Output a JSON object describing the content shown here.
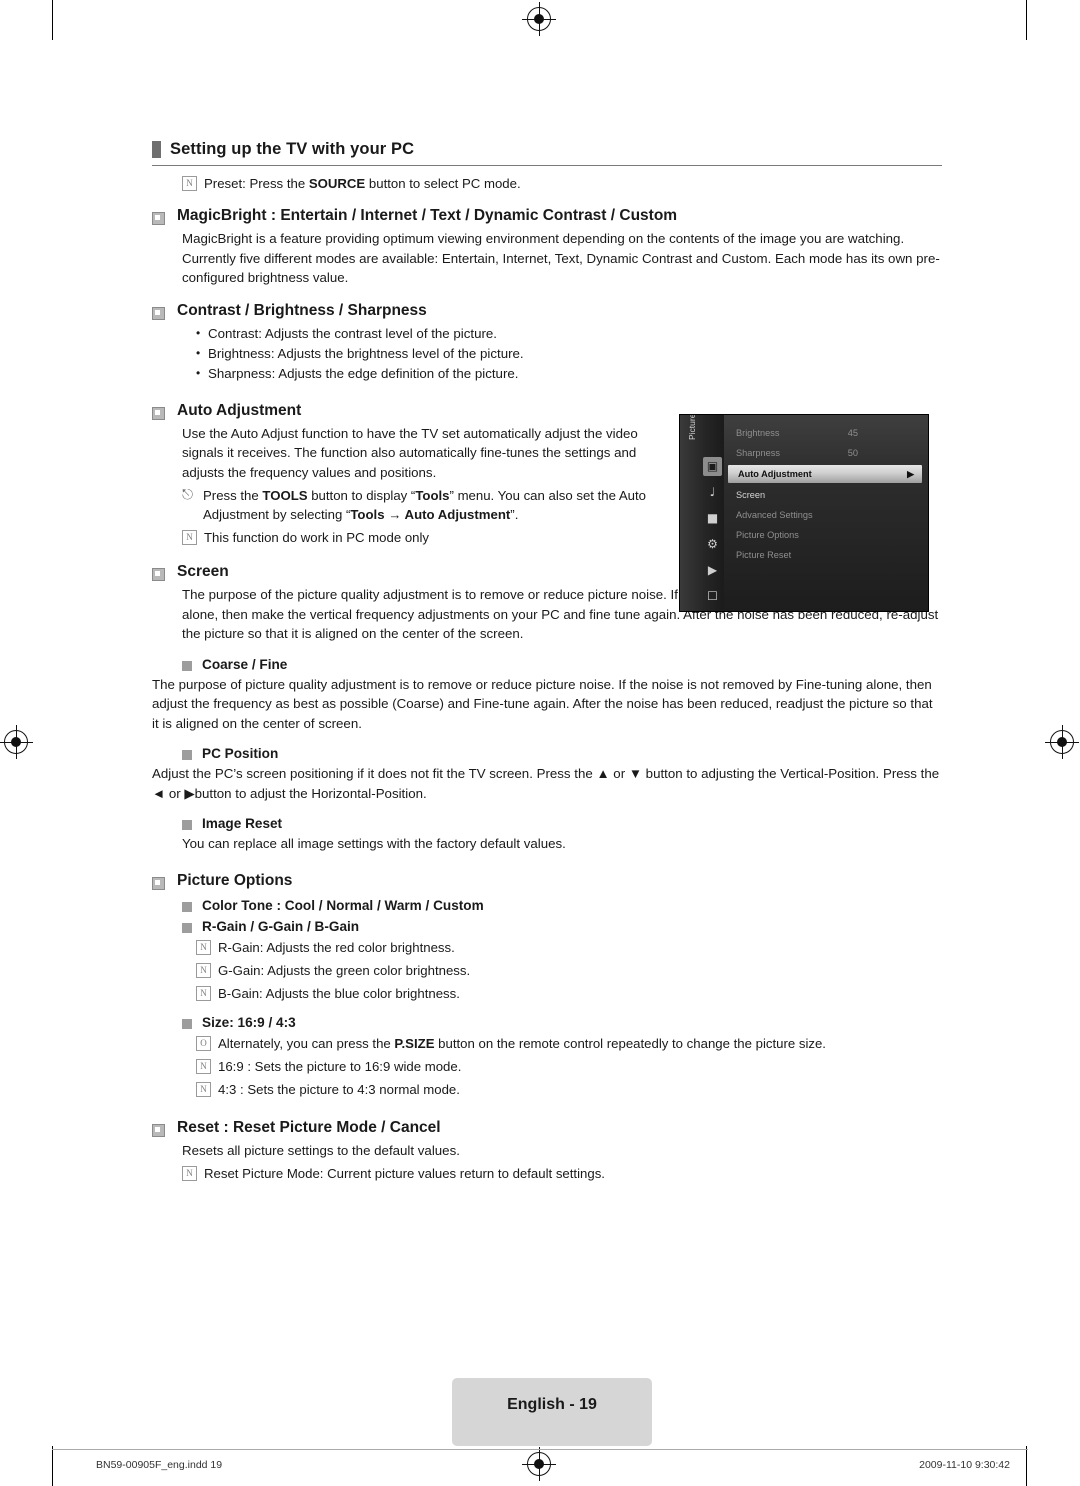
{
  "document": {
    "section_title": "Setting up the TV with your PC",
    "preset_note": "Preset: Press the SOURCE button to select PC mode.",
    "headings": {
      "magicbright": "MagicBright : Entertain / Internet / Text / Dynamic Contrast / Custom",
      "contrast": "Contrast / Brightness / Sharpness",
      "auto_adjustment": "Auto Adjustment",
      "screen": "Screen",
      "coarse_fine": "Coarse / Fine",
      "pc_position": "PC Position",
      "image_reset": "Image Reset",
      "picture_options": "Picture Options",
      "color_tone": "Color Tone : Cool / Normal / Warm / Custom",
      "gains": "R-Gain / G-Gain / B-Gain",
      "size": "Size: 16:9 / 4:3",
      "reset": "Reset : Reset Picture Mode / Cancel"
    },
    "magicbright_body": "MagicBright is a feature providing optimum viewing environment depending on the contents of the image you are watching. Currently five different modes are available: Entertain, Internet, Text, Dynamic Contrast and Custom. Each mode has its own pre-configured brightness value.",
    "contrast_bullets": [
      "Contrast: Adjusts the contrast level of the picture.",
      "Brightness: Adjusts the brightness level of the picture.",
      "Sharpness: Adjusts the edge definition of the picture."
    ],
    "auto_adjustment_body": "Use the Auto Adjust function to have the TV set automatically adjust the video signals it receives. The function also automatically fine-tunes the settings and adjusts the frequency values and positions.",
    "tools_note": "Press the TOOLS button to display “Tools” menu. You can also set the Auto Adjustment by selecting “Tools → Auto Adjustment”.",
    "pc_mode_note": "This function do work in PC mode only",
    "screen_body": "The purpose of the picture quality adjustment is to remove or reduce picture noise. If the noise is not removed by fine tuning alone, then make the vertical frequency adjustments on your PC and fine tune again. After the noise has been reduced, re-adjust the picture so that it is aligned on the center of the screen.",
    "coarse_fine_body": "The purpose of picture quality adjustment is to remove or reduce picture noise. If the noise is not removed by Fine-tuning alone, then adjust the frequency as best as possible (Coarse) and Fine-tune again. After the noise has been reduced, readjust the picture so that it is aligned on the center of screen.",
    "pc_position_body": "Adjust the PC’s screen positioning if it does not fit the TV screen. Press the ▲ or ▼ button to adjusting the Vertical-Position. Press the ◄ or ▶button to adjust the Horizontal-Position.",
    "image_reset_body": "You can replace all image settings with the factory default values.",
    "gain_notes": [
      "R-Gain: Adjusts the red color brightness.",
      "G-Gain: Adjusts the green color brightness.",
      "B-Gain: Adjusts the blue color brightness."
    ],
    "size_notes": [
      "Alternately, you can press the P.SIZE button on the remote control repeatedly to change the picture size.",
      "16:9 : Sets the picture to 16:9 wide mode.",
      "4:3 : Sets the picture to 4:3 normal mode."
    ],
    "reset_body": "Resets all picture settings to the default values.",
    "reset_note": "Reset Picture Mode: Current picture values return to default settings."
  },
  "osd": {
    "rail_label": "Picture",
    "rows": [
      {
        "label": "Brightness",
        "value": "45",
        "state": "dim"
      },
      {
        "label": "Sharpness",
        "value": "50",
        "state": "dim"
      },
      {
        "label": "Auto Adjustment",
        "value": "",
        "state": "highlight",
        "arrow": "▶"
      },
      {
        "label": "Screen",
        "value": "",
        "state": "normal"
      },
      {
        "label": "Advanced Settings",
        "value": "",
        "state": "dim"
      },
      {
        "label": "Picture Options",
        "value": "",
        "state": "dim"
      },
      {
        "label": "Picture Reset",
        "value": "",
        "state": "dim"
      }
    ]
  },
  "footer": {
    "page_label": "English - 19",
    "file_info": "BN59-00905F_eng.indd   19",
    "timestamp": "2009-11-10   9:30:42"
  }
}
